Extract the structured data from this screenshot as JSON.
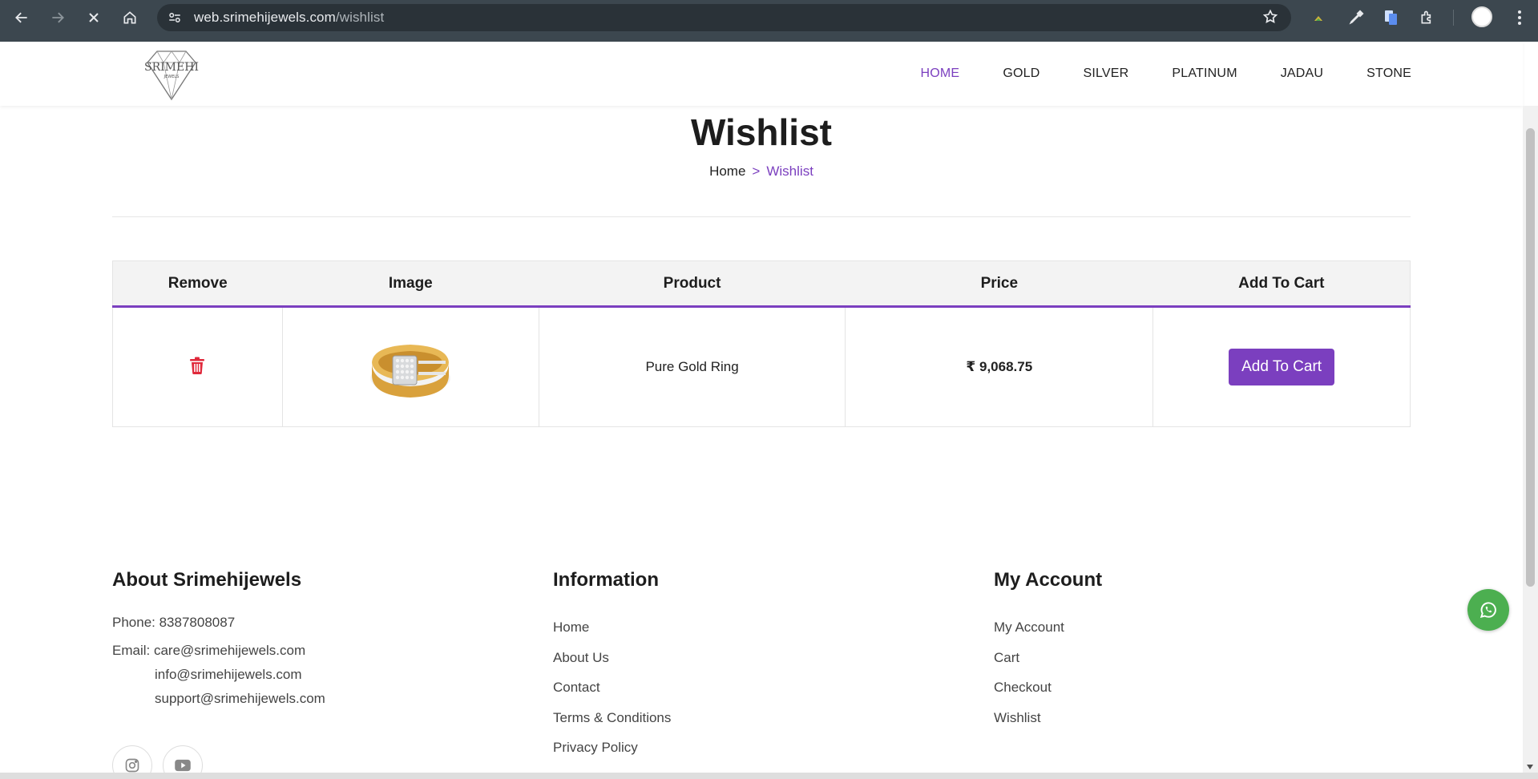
{
  "browser": {
    "url_host": "web.srimehijewels.com",
    "url_path": "/wishlist"
  },
  "header": {
    "logo_text": "SRIMEHI",
    "nav": [
      {
        "label": "HOME",
        "active": true
      },
      {
        "label": "GOLD",
        "active": false
      },
      {
        "label": "SILVER",
        "active": false
      },
      {
        "label": "PLATINUM",
        "active": false
      },
      {
        "label": "JADAU",
        "active": false
      },
      {
        "label": "STONE",
        "active": false
      }
    ]
  },
  "page": {
    "title": "Wishlist",
    "breadcrumb": {
      "home": "Home",
      "separator": ">",
      "current": "Wishlist"
    }
  },
  "wishlist": {
    "columns": [
      "Remove",
      "Image",
      "Product",
      "Price",
      "Add To Cart"
    ],
    "rows": [
      {
        "product": "Pure Gold Ring",
        "currency": "₹",
        "price": "9,068.75",
        "button": "Add To Cart"
      }
    ]
  },
  "footer": {
    "about": {
      "title": "About Srimehijewels",
      "phone": "Phone: 8387808087",
      "email_label": "Email: care@srimehijewels.com",
      "email_2": "info@srimehijewels.com",
      "email_3": "support@srimehijewels.com"
    },
    "information": {
      "title": "Information",
      "links": [
        "Home",
        "About Us",
        "Contact",
        "Terms & Conditions",
        "Privacy Policy"
      ]
    },
    "account": {
      "title": "My Account",
      "links": [
        "My Account",
        "Cart",
        "Checkout",
        "Wishlist"
      ]
    }
  },
  "colors": {
    "accent": "#7b3fbf",
    "danger": "#e0293b",
    "whatsapp": "#4caf50"
  },
  "icons": [
    "back-icon",
    "forward-icon",
    "stop-icon",
    "home-icon",
    "site-settings-icon",
    "star-icon",
    "trash-icon",
    "instagram-icon",
    "youtube-icon",
    "whatsapp-icon"
  ]
}
